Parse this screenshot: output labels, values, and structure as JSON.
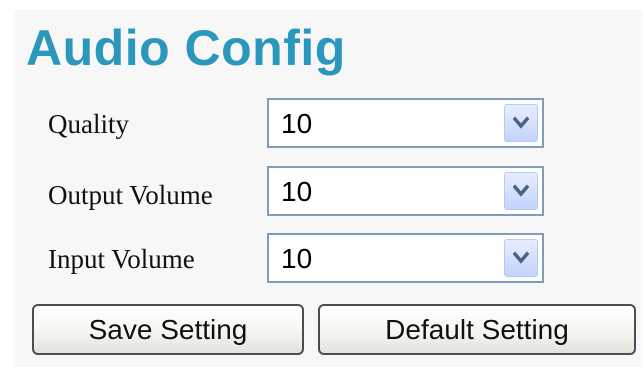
{
  "title": "Audio Config",
  "fields": [
    {
      "label": "Quality",
      "value": "10"
    },
    {
      "label": "Output Volume",
      "value": "10"
    },
    {
      "label": "Input Volume",
      "value": "10"
    }
  ],
  "buttons": {
    "save_label": "Save Setting",
    "default_label": "Default Setting"
  },
  "colors": {
    "title": "#2b97bd",
    "panel_background": "#f7f7f7",
    "select_border": "#7f9db9",
    "dropdown_arrow": "#4d6185"
  },
  "icons": {
    "dropdown": "chevron-down-icon"
  }
}
